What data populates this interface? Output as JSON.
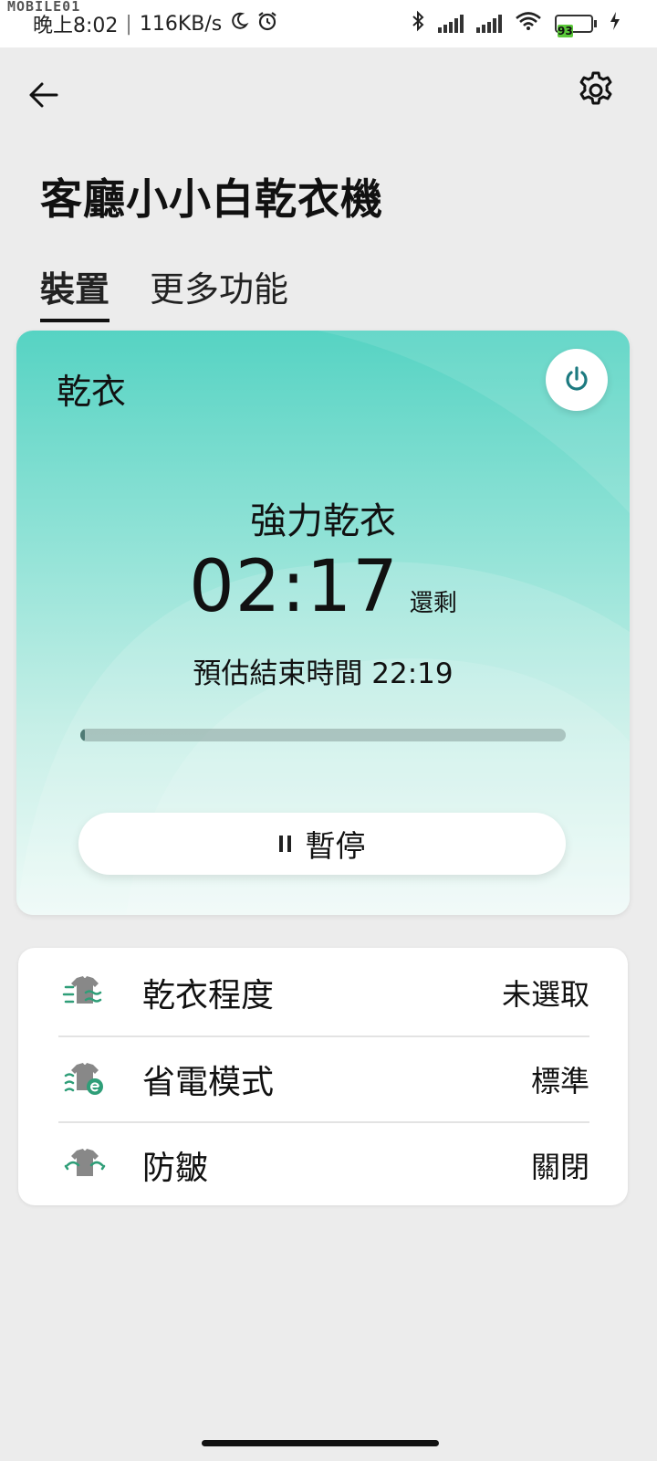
{
  "status_bar": {
    "watermark": "MOBILE01",
    "time": "晚上8:02",
    "network_speed": "116KB/s",
    "battery_level": "93",
    "battery_color": "#5cc93a"
  },
  "header": {
    "title": "客廳小小白乾衣機",
    "back_icon": "arrow-left-icon",
    "settings_icon": "gear-icon"
  },
  "tabs": [
    {
      "label": "裝置",
      "active": true
    },
    {
      "label": "更多功能",
      "active": false
    }
  ],
  "main_card": {
    "mode_label": "乾衣",
    "program": "強力乾衣",
    "time_remaining": "02:17",
    "remaining_label": "還剩",
    "end_time": "預估結束時間 22:19",
    "progress": 0.01,
    "pause_label": "暫停",
    "accent_color": "#1c7a80",
    "gradient_top": "#56d3c3",
    "gradient_bottom": "#eefaf7"
  },
  "settings": [
    {
      "icon": "shirt-dryness-icon",
      "label": "乾衣程度",
      "value": "未選取"
    },
    {
      "icon": "shirt-eco-icon",
      "label": "省電模式",
      "value": "標準"
    },
    {
      "icon": "shirt-anti-wrinkle-icon",
      "label": "防皺",
      "value": "關閉"
    }
  ]
}
